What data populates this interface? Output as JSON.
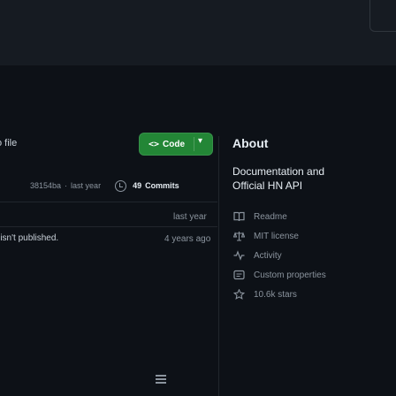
{
  "header": {},
  "toolbar": {
    "go_to_file_label": "o file",
    "code_button_label": "Code",
    "code_icon": "<>",
    "caret": "▾"
  },
  "latest_commit": {
    "hash": "38154ba",
    "separator": "·",
    "time": "last year",
    "commits_count": "49",
    "commits_label": "Commits"
  },
  "file_rows": [
    {
      "time": "last year"
    },
    {
      "time": "4 years ago"
    }
  ],
  "readme": {
    "message": "It isn't published."
  },
  "about": {
    "heading": "About",
    "description_line1": "Documentation and",
    "description_line2": "Official HN API",
    "links": [
      {
        "icon": "book-icon",
        "label": "Readme"
      },
      {
        "icon": "law-icon",
        "label": "MIT license"
      },
      {
        "icon": "pulse-icon",
        "label": "Activity"
      },
      {
        "icon": "note-icon",
        "label": "Custom properties"
      },
      {
        "icon": "star-icon",
        "label": "10.6k stars"
      }
    ]
  },
  "colors": {
    "background": "#0d1117",
    "accent_green": "#238636",
    "muted_text": "#8b949e"
  }
}
